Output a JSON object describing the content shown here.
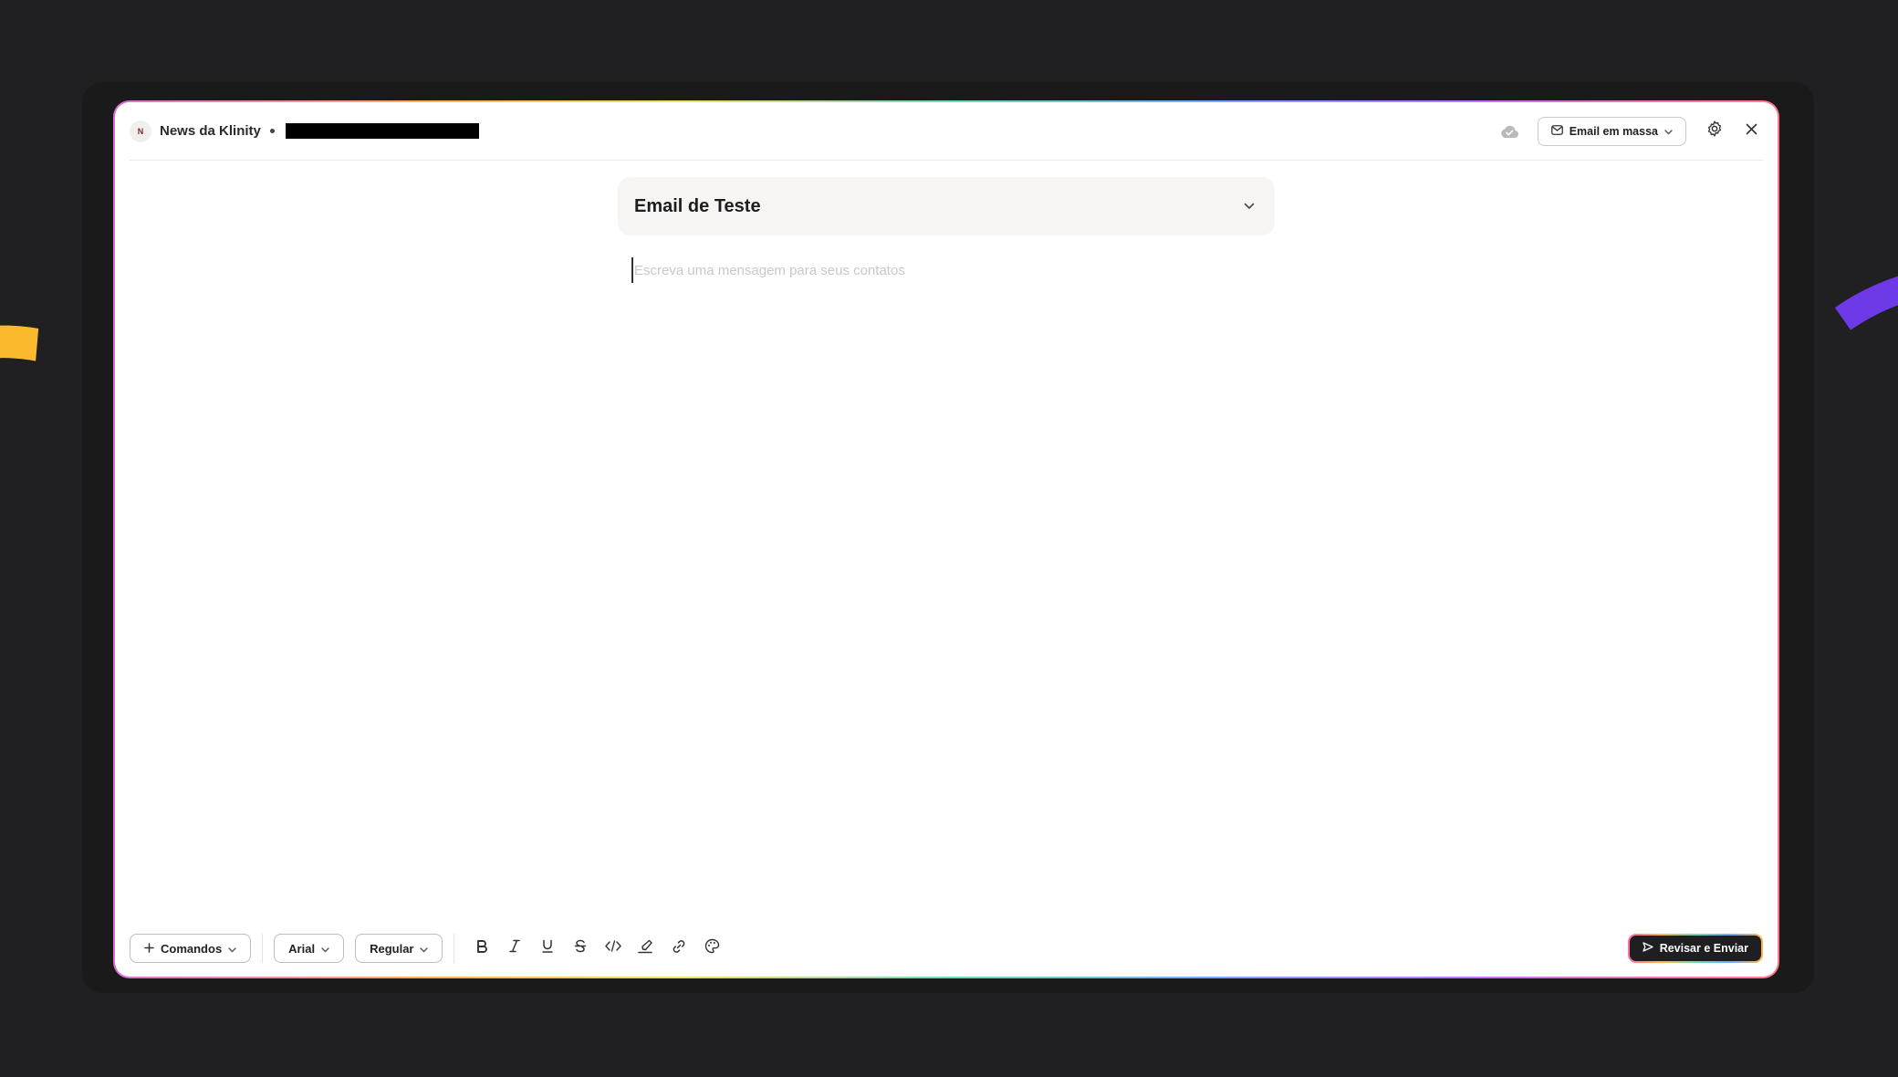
{
  "header": {
    "avatar_initial": "N",
    "title": "News da Klinity",
    "mode_label": "Email em massa"
  },
  "composer": {
    "recipient_label": "Email de Teste",
    "placeholder": "Escreva uma mensagem para seus contatos"
  },
  "toolbar": {
    "commands_label": "Comandos",
    "font_label": "Arial",
    "weight_label": "Regular",
    "send_label": "Revisar e Enviar",
    "format_icons": [
      "bold-icon",
      "italic-icon",
      "underline-icon",
      "strikethrough-icon",
      "code-icon",
      "highlight-icon",
      "link-icon",
      "palette-icon"
    ]
  },
  "colors": {
    "background": "#202022",
    "accent_yellow": "#fbb92e",
    "accent_purple": "#6e3ae8",
    "send_button": "#1f1f21"
  }
}
